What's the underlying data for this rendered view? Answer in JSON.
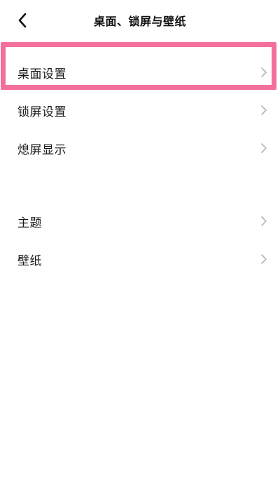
{
  "header": {
    "title": "桌面、锁屏与壁纸",
    "back_icon": "chevron-left-icon"
  },
  "groups": [
    {
      "items": [
        {
          "label": "桌面设置",
          "icon": "chevron-right-icon"
        },
        {
          "label": "锁屏设置",
          "icon": "chevron-right-icon"
        },
        {
          "label": "熄屏显示",
          "icon": "chevron-right-icon"
        }
      ]
    },
    {
      "items": [
        {
          "label": "主题",
          "icon": "chevron-right-icon"
        },
        {
          "label": "壁纸",
          "icon": "chevron-right-icon"
        }
      ]
    }
  ],
  "colors": {
    "highlight": "#f2709a",
    "chevron": "#b5b5b5",
    "text": "#1a1a1a"
  }
}
